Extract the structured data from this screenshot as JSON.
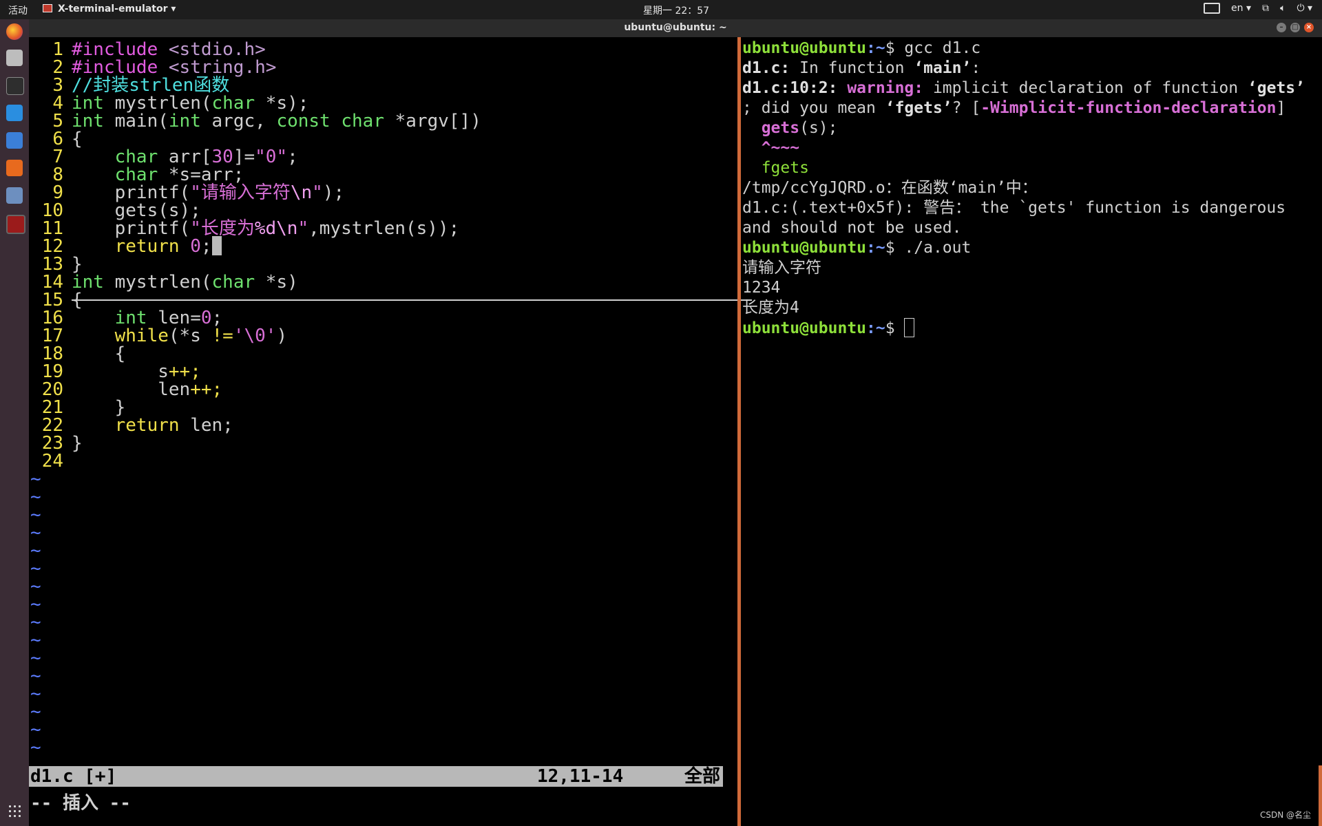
{
  "topbar": {
    "activities": "活动",
    "app_name": "X-terminal-emulator",
    "clock": "星期一 22：57",
    "lang": "en"
  },
  "terminal_window": {
    "title": "ubuntu@ubuntu: ~"
  },
  "vim": {
    "lines": [
      {
        "n": "1"
      },
      {
        "n": "2"
      },
      {
        "n": "3"
      },
      {
        "n": "4"
      },
      {
        "n": "5"
      },
      {
        "n": "6"
      },
      {
        "n": "7"
      },
      {
        "n": "8"
      },
      {
        "n": "9"
      },
      {
        "n": "10"
      },
      {
        "n": "11"
      },
      {
        "n": "12"
      },
      {
        "n": "13"
      },
      {
        "n": "14"
      },
      {
        "n": "15"
      },
      {
        "n": "16"
      },
      {
        "n": "17"
      },
      {
        "n": "18"
      },
      {
        "n": "19"
      },
      {
        "n": "20"
      },
      {
        "n": "21"
      },
      {
        "n": "22"
      },
      {
        "n": "23"
      },
      {
        "n": "24"
      }
    ],
    "code": {
      "l1a": "#include ",
      "l1b": "<stdio.h>",
      "l2a": "#include ",
      "l2b": "<string.h>",
      "l3": "//封装strlen函数",
      "l4a": "int",
      " l4b": " mystrlen(",
      "l4c": "char",
      " l4d": " *s);",
      "l5a": "int",
      "l5b": " main(",
      "l5c": "int",
      "l5d": " argc, ",
      "l5e": "const char",
      " l5f": " *argv[])",
      "l6": "{",
      "l7a": "    char",
      "l7b": " arr[",
      "l7c": "30",
      "l7d": "]=",
      "l7e": "\"0\"",
      "l7f": ";",
      "l8a": "    char",
      "l8b": " *s=arr;",
      "l9a": "    printf(",
      "l9b": "\"请输入字符",
      "l9c": "\\n",
      "l9d": "\"",
      "l9e": ");",
      "l10": "    gets(s);",
      "l11a": "    printf(",
      "l11b": "\"长度为",
      "l11c": "%d\\n",
      "l11d": "\"",
      "l11e": ",mystrlen(s));",
      "l12a": "    return ",
      "l12b": "0",
      "l12c": ";",
      "l13": "}",
      "l14a": "int",
      "l14b": " mystrlen(",
      "l14c": "char",
      "l14d": " *s)",
      "l15": "{",
      "l16a": "    int",
      "l16b": " len=",
      "l16c": "0",
      "l16d": ";",
      "l17a": "    while",
      "l17b": "(*s ",
      "l17c": "!=",
      "l17d": "'\\0'",
      "l17e": ")",
      "l18": "    {",
      "l19a": "        s",
      "l19b": "++;",
      "l20a": "        len",
      "l20b": "++;",
      "l21": "    }",
      "l22a": "    return",
      "l22b": " len;",
      "l23": "}",
      "tilde": "~"
    },
    "status": {
      "file": "d1.c [+]",
      "position": "12,11-14",
      "scroll": "全部",
      "mode": "-- 插入 --"
    }
  },
  "terminal": {
    "user": "ubuntu@ubuntu",
    "path": ":~",
    "dollar": "$ ",
    "cmd1": "gcc d1.c",
    "o1a": "d1.c:",
    "o1b": " In function ",
    "o1c": "‘main’",
    "o1d": ":",
    "o2a": "d1.c:10:2: ",
    "o2b": "warning: ",
    "o2c": "implicit declaration of function ",
    "o2d": "‘gets’",
    "o3a": "; did you mean ",
    "o3b": "‘fgets’",
    "o3c": "? [",
    "o3d": "-Wimplicit-function-declaration",
    "o3e": "]",
    "o4a": "  gets",
    "o4b": "(s);",
    "o5": "  ^~~~",
    "o6": "  fgets",
    "o7": "/tmp/ccYgJQRD.o：在函数‘main’中：",
    "o8": "d1.c:(.text+0x5f): 警告： the `gets' function is dangerous",
    "o9": "and should not be used.",
    "cmd2": "./a.out",
    "o10": "请输入字符",
    "o11": "1234",
    "o12": "长度为4",
    "watermark": "CSDN @名尘"
  }
}
